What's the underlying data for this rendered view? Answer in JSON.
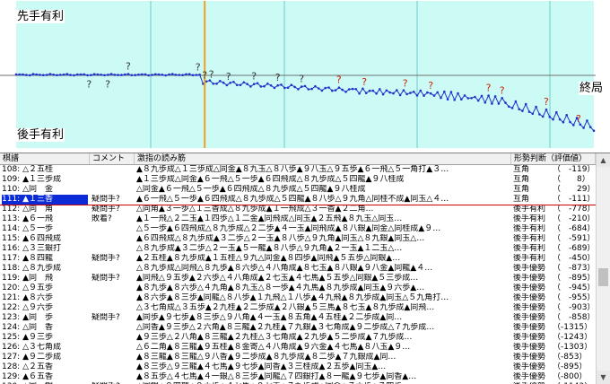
{
  "graph": {
    "top_label": "先手有利",
    "bottom_label": "後手有利",
    "end_label": "終局",
    "current_index": 111,
    "question_marks": [
      {
        "index": 43,
        "side": "below"
      },
      {
        "index": 54,
        "side": "below"
      },
      {
        "index": 66,
        "side": "above"
      },
      {
        "index": 107,
        "side": "above"
      },
      {
        "index": 111,
        "side": "above"
      },
      {
        "index": 115,
        "side": "above"
      },
      {
        "index": 125,
        "side": "above"
      },
      {
        "index": 140,
        "side": "above"
      },
      {
        "index": 154,
        "side": "above"
      },
      {
        "index": 168,
        "side": "above"
      },
      {
        "index": 190,
        "side": "above"
      },
      {
        "index": 205,
        "side": "above"
      },
      {
        "index": 229,
        "side": "above"
      },
      {
        "index": 244,
        "side": "above"
      },
      {
        "index": 278,
        "side": "above"
      },
      {
        "index": 286,
        "side": "above"
      },
      {
        "index": 312,
        "side": "above"
      },
      {
        "index": 331,
        "side": "above"
      }
    ],
    "colors": {
      "background": "#ffffff",
      "plot": "#ccfbf6",
      "line": "#2233cc",
      "cursor": "#f0a020",
      "grid": "#70c8c8",
      "mark": "#cc2200"
    }
  },
  "list": {
    "headers": {
      "move": "棋譜",
      "comment": "コメント",
      "pv": "激指の読み筋",
      "judge": "形勢判断（評価値）"
    },
    "selected_index": 3,
    "rows": [
      {
        "move": "108: △２五桂",
        "comment": "",
        "pv": "▲８九歩成△１三歩成△同金▲８九玉△８八歩▲９八玉△９五歩▲６一飛△５一角打▲３…",
        "judge": "互角",
        "value": "（　-119）"
      },
      {
        "move": "109: ▲１三歩成",
        "comment": "",
        "pv": "▲１三歩成△同金▲６一飛△５一歩▲６四飛成△８九歩成△５四龍▲９八桂成",
        "judge": "互角",
        "value": "（　　8）"
      },
      {
        "move": "110: △同　金",
        "comment": "",
        "pv": "△同金▲６一飛△５一歩▲６四飛成△８九歩成△５四龍▲９八桂成",
        "judge": "互角",
        "value": "（　　29）"
      },
      {
        "move": "111: ▲１三香",
        "comment": "疑問手?",
        "pv": "▲６一飛△５一歩▲６四飛成△８九歩成△５四龍▲８八歩△９九角△同桂不成▲同玉△４…",
        "judge": "互角",
        "value": "（　-111）"
      },
      {
        "move": "112: △同　角",
        "comment": "疑問手?",
        "pv": "△同角▲３一歩△１三香成△８九歩成▲１一飛成△３一香▲２二角…",
        "judge": "後手有利",
        "value": "（　-778）"
      },
      {
        "move": "113: ▲６一飛",
        "comment": "敗着?",
        "pv": "▲１一飛△２二玉▲１四歩△１二金▲同飛成△同玉▲２五飛▲８九玉△同玉…",
        "judge": "後手有利",
        "value": "（　-210）"
      },
      {
        "move": "114: △５一歩",
        "comment": "",
        "pv": "△５一歩▲６四飛成△８九歩成△２二歩▲４一玉▲同飛成▲８八銀▲同金△同桂成▲９…",
        "judge": "後手有利",
        "value": "（　-684）"
      },
      {
        "move": "115: ▲６四飛成",
        "comment": "",
        "pv": "▲６四飛成△８九歩成▲３二歩△２一玉▲８八歩△９九角▲同玉△８九銀▲同玉△…",
        "judge": "後手有利",
        "value": "（　-591）"
      },
      {
        "move": "116: △３三銀打",
        "comment": "",
        "pv": "△８九歩成▲３二歩△２一玉▲５一龍▲８八歩△９九角▲２一玉▲１二玉△…",
        "judge": "後手有利",
        "value": "（　-689）"
      },
      {
        "move": "117: ▲８四龍",
        "comment": "疑問手?",
        "pv": "▲２五桂▲８九歩成▲１五桂△９九△同金▲８四歩▲同飛▲５五歩△同銀▲…",
        "judge": "後手有利",
        "value": "（　-450）"
      },
      {
        "move": "118: △８九歩成",
        "comment": "",
        "pv": "△８九歩成△同飛△８九歩▲８六歩△４八角成▲８七玉▲８八銀▲９八金▲同龍▲４…",
        "judge": "後手優勢",
        "value": "（　-873）"
      },
      {
        "move": "119: ▲同　飛",
        "comment": "疑問手?",
        "pv": "▲同飛△９五歩▲２六歩△４八角成▲２七玉▲４七馬▲５五歩△同銀▲５三歩成…",
        "judge": "後手優勢",
        "value": "（　-895）"
      },
      {
        "move": "120: △９五歩",
        "comment": "",
        "pv": "▲８九歩▲８六歩△４九角▲８九玉△８一歩▲４九馬▲８九歩成▲同玉▲９六歩▲…",
        "judge": "後手優勢",
        "value": "（　-945）"
      },
      {
        "move": "121: ▲８六歩",
        "comment": "",
        "pv": "▲８六歩▲８三歩▲同龍△８八歩▲１九飛△１八歩▲４九飛▲８九歩成▲同玉△５九角打…",
        "judge": "後手優勢",
        "value": "（　-955）"
      },
      {
        "move": "122: △９六歩",
        "comment": "",
        "pv": "△３七角成△３五歩▲２九桂▲２二歩成▲２八銀▲５三馬▲８七玉▲８九歩成▲同飛…",
        "judge": "後手優勢",
        "value": "（　-903）"
      },
      {
        "move": "123: ▲同　歩",
        "comment": "疑問手?",
        "pv": "▲同歩▲９七歩▲８三歩△９八角▲４一玉▲８五角▲４五桂▲２二歩成▲同…",
        "judge": "後手優勢",
        "value": "（　-858）"
      },
      {
        "move": "124: △同　香",
        "comment": "",
        "pv": "△同香▲９三歩△２六角▲８三龍▲２九桂▲７九銀▲３七角成▲９二歩成△７九歩成…",
        "judge": "後手優勢",
        "value": "（-1315）"
      },
      {
        "move": "125: ▲９三歩",
        "comment": "",
        "pv": "▲９三歩△２八角▲８三龍▲２九桂△３七角成▲２九歩▲５二歩成▲７九歩成…",
        "judge": "後手優勢",
        "value": "（-1243）"
      },
      {
        "move": "126: △３七角成",
        "comment": "",
        "pv": "△６二角▲８三龍▲９五桂▲８金寄△４八角成▲９六金▲４七馬▲８八玉▲９…",
        "judge": "後手優勢",
        "value": "（-1303）"
      },
      {
        "move": "127: ▲９二歩成",
        "comment": "",
        "pv": "▲８三龍▲８三龍△９八香▲９二歩成▲８九歩成▲８二歩▲７九銀成▲同…",
        "judge": "後手優勢",
        "value": "（-853）"
      },
      {
        "move": "128: △２五香",
        "comment": "",
        "pv": "▲８三歩△９三龍▲４七馬▲９七歩▲同香▲３三桂成▲２五歩▲同玉▲…",
        "judge": "後手優勢",
        "value": "（-895）"
      },
      {
        "move": "129: ▲６五香",
        "comment": "",
        "pv": "▲８五歩△４七馬▲４一銀△８三歩▲同龍△７四銀打▲８一龍▲９七歩▲同香▲…",
        "judge": "後手優勢",
        "value": "（-800）"
      },
      {
        "move": "130: △同　銀",
        "comment": "疑問手?",
        "pv": "△同銀▲８四龍▲８六歩△４七馬▲８七玉▲７九歩成▲同金△７六歩▲７四歩…",
        "judge": "後手優勢",
        "value": "（-1143）"
      }
    ]
  }
}
